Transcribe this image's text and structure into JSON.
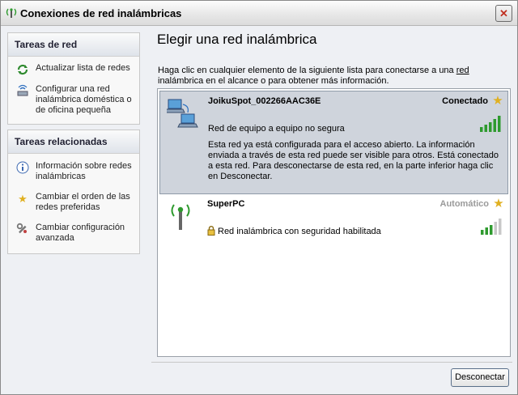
{
  "window": {
    "title": "Conexiones de red inalámbricas",
    "close_label": "✕"
  },
  "sidebar": {
    "network_tasks": {
      "heading": "Tareas de red",
      "items": [
        {
          "label": "Actualizar lista de redes",
          "icon": "refresh-icon"
        },
        {
          "label": "Configurar una red inalámbrica doméstica o de oficina pequeña",
          "icon": "wireless-setup-icon"
        }
      ]
    },
    "related_tasks": {
      "heading": "Tareas relacionadas",
      "items": [
        {
          "label": "Información sobre redes inalámbricas",
          "icon": "info-icon"
        },
        {
          "label": "Cambiar el orden de las redes preferidas",
          "icon": "star-icon"
        },
        {
          "label": "Cambiar configuración avanzada",
          "icon": "wrench-icon"
        }
      ]
    }
  },
  "main": {
    "title": "Elegir una red inalámbrica",
    "instructions_pre": "Haga clic en cualquier elemento de la siguiente lista para conectarse a una ",
    "instructions_link": "red",
    "instructions_post": " inalámbrica en el alcance o para obtener más información."
  },
  "networks": [
    {
      "name": "JoikuSpot_002266AAC36E",
      "status": "Conectado",
      "type": "Red de equipo a equipo no segura",
      "description": "Esta red ya está configurada para el acceso abierto. La información enviada a través de esta red puede ser visible para otros. Está conectado a esta red. Para desconectarse de esta red, en la parte inferior haga clic en Desconectar.",
      "signal_bars": 5,
      "selected": true
    },
    {
      "name": "SuperPC",
      "status": "Automático",
      "type": "Red inalámbrica con seguridad habilitada",
      "signal_bars": 3,
      "selected": false
    }
  ],
  "buttons": {
    "disconnect": "Desconectar"
  },
  "colors": {
    "status_connected": "#000000",
    "status_auto": "#9a9a9a",
    "signal_on": "#2e9a2e",
    "signal_off": "#c8c8c8",
    "star": "#e0b020"
  }
}
